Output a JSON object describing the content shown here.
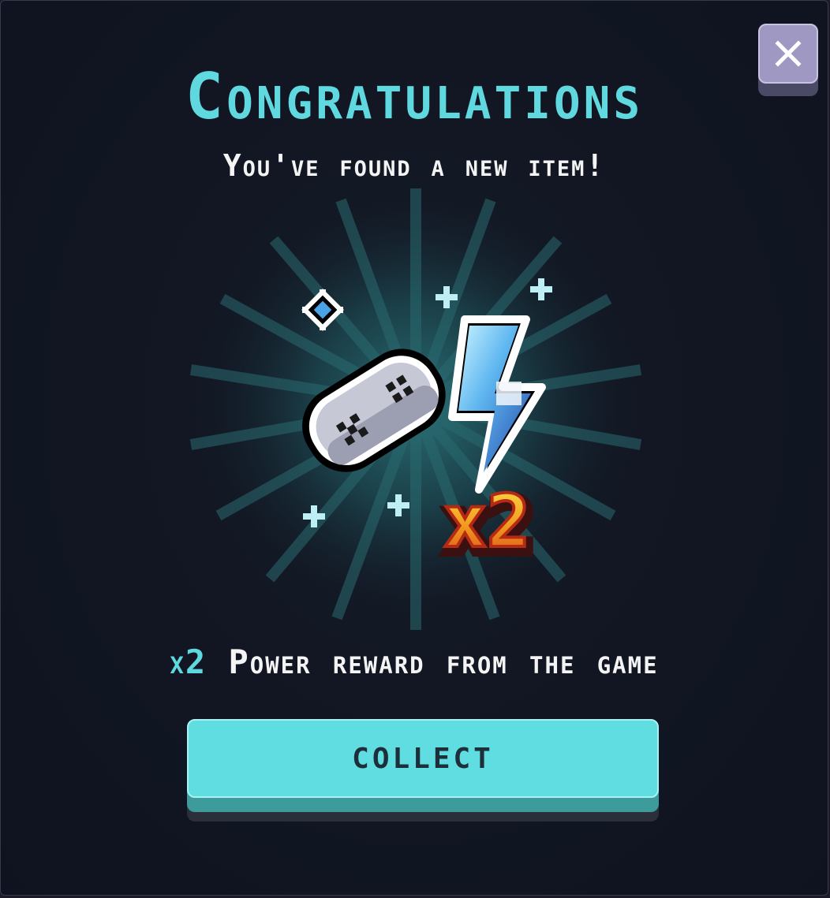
{
  "dialog": {
    "title": "Congratulations",
    "subtitle": "You've found a new item!",
    "close_icon": "close-icon"
  },
  "item": {
    "icons": [
      "gamepad-icon",
      "lightning-bolt-icon",
      "sparkle-icon"
    ],
    "multiplier_badge": "x2"
  },
  "reward": {
    "multiplier": "x2",
    "text": "Power reward from the game"
  },
  "actions": {
    "collect_label": "COLLECT"
  },
  "colors": {
    "accent": "#5fd9df",
    "background": "#111622",
    "button": "#60dde0",
    "close_button": "#9f98c2"
  }
}
